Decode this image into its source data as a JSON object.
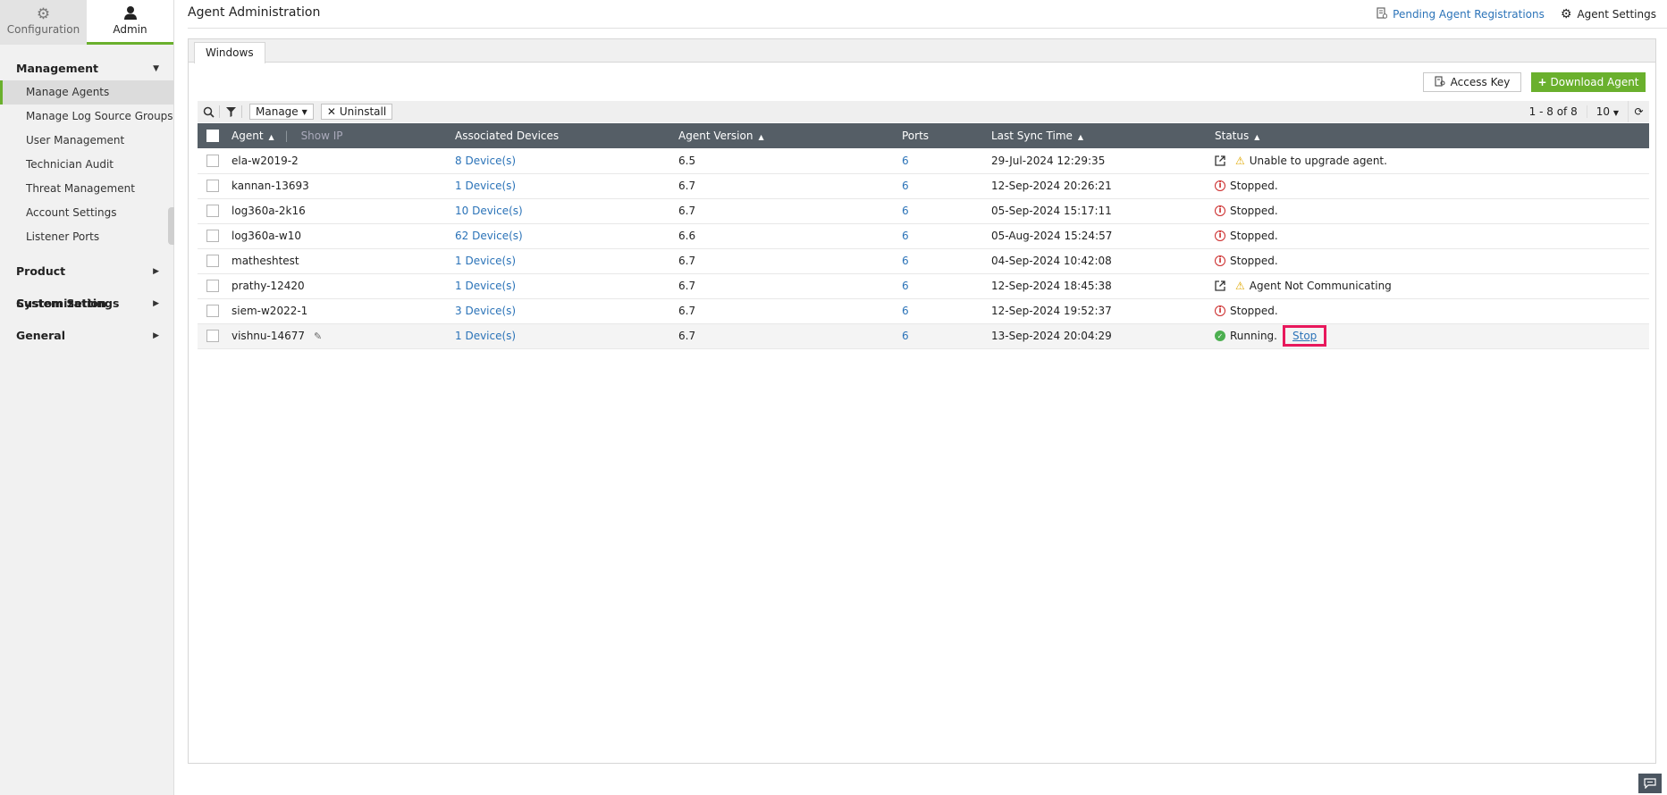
{
  "sidebar": {
    "top_tabs": [
      {
        "label": "Configuration",
        "icon": "gear-icon",
        "active": false
      },
      {
        "label": "Admin",
        "icon": "user-icon",
        "active": true
      }
    ],
    "management": {
      "label": "Management",
      "items": [
        {
          "label": "Manage Agents",
          "active": true
        },
        {
          "label": "Manage Log Source Groups"
        },
        {
          "label": "User Management"
        },
        {
          "label": "Technician Audit"
        },
        {
          "label": "Threat Management"
        },
        {
          "label": "Account Settings"
        },
        {
          "label": "Listener Ports"
        }
      ]
    },
    "sections": [
      "Product Customization",
      "System Settings",
      "General"
    ]
  },
  "header": {
    "title": "Agent Administration",
    "pending_label": "Pending Agent Registrations",
    "settings_label": "Agent Settings"
  },
  "tabs": {
    "windows": "Windows"
  },
  "actions": {
    "access_key": "Access Key",
    "download_agent": "Download Agent"
  },
  "toolbar": {
    "manage": "Manage",
    "uninstall": "Uninstall",
    "range": "1 - 8 of 8",
    "page_size": "10"
  },
  "table": {
    "columns": {
      "agent": "Agent",
      "show_ip": "Show IP",
      "devices": "Associated Devices",
      "version": "Agent Version",
      "ports": "Ports",
      "sync": "Last Sync Time",
      "status": "Status"
    },
    "rows": [
      {
        "agent": "ela-w2019-2",
        "devices": "8 Device(s)",
        "version": "6.5",
        "ports": "6",
        "sync": "29-Jul-2024 12:29:35",
        "status": "Unable to upgrade agent.",
        "kind": "warn"
      },
      {
        "agent": "kannan-13693",
        "devices": "1 Device(s)",
        "version": "6.7",
        "ports": "6",
        "sync": "12-Sep-2024 20:26:21",
        "status": "Stopped.",
        "kind": "stopped"
      },
      {
        "agent": "log360a-2k16",
        "devices": "10 Device(s)",
        "version": "6.7",
        "ports": "6",
        "sync": "05-Sep-2024 15:17:11",
        "status": "Stopped.",
        "kind": "stopped"
      },
      {
        "agent": "log360a-w10",
        "devices": "62 Device(s)",
        "version": "6.6",
        "ports": "6",
        "sync": "05-Aug-2024 15:24:57",
        "status": "Stopped.",
        "kind": "stopped"
      },
      {
        "agent": "matheshtest",
        "devices": "1 Device(s)",
        "version": "6.7",
        "ports": "6",
        "sync": "04-Sep-2024 10:42:08",
        "status": "Stopped.",
        "kind": "stopped"
      },
      {
        "agent": "prathy-12420",
        "devices": "1 Device(s)",
        "version": "6.7",
        "ports": "6",
        "sync": "12-Sep-2024 18:45:38",
        "status": "Agent Not Communicating",
        "kind": "warn"
      },
      {
        "agent": "siem-w2022-1",
        "devices": "3 Device(s)",
        "version": "6.7",
        "ports": "6",
        "sync": "12-Sep-2024 19:52:37",
        "status": "Stopped.",
        "kind": "stopped"
      },
      {
        "agent": "vishnu-14677",
        "devices": "1 Device(s)",
        "version": "6.7",
        "ports": "6",
        "sync": "13-Sep-2024 20:04:29",
        "status": "Running.",
        "kind": "running",
        "action": "Stop"
      }
    ]
  },
  "colors": {
    "accent": "#6ab02d",
    "header_bg": "#555e66",
    "link": "#2b73b8",
    "highlight": "#e8185c"
  }
}
